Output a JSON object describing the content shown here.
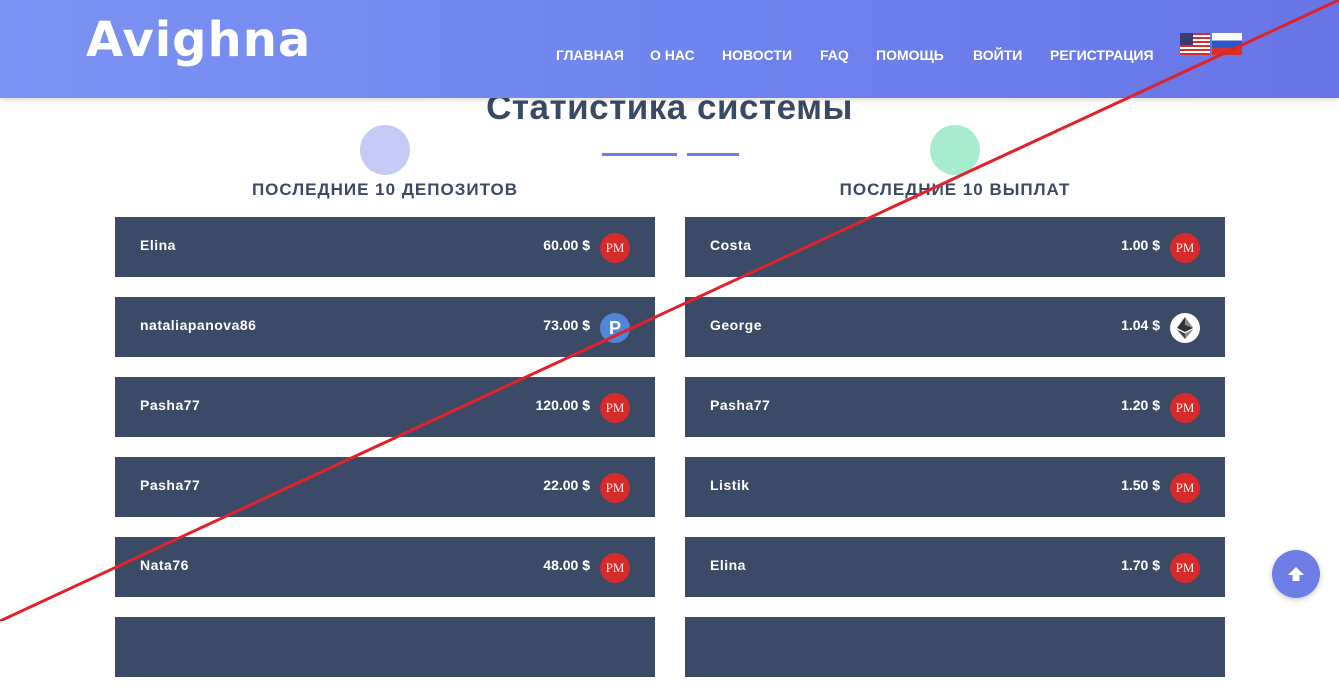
{
  "header": {
    "logo": "Avighna",
    "nav": [
      {
        "label": "ГЛАВНАЯ"
      },
      {
        "label": "О НАС"
      },
      {
        "label": "НОВОСТИ"
      },
      {
        "label": "FAQ"
      },
      {
        "label": "ПОМОЩЬ"
      },
      {
        "label": "ВОЙТИ"
      },
      {
        "label": "РЕГИСТРАЦИЯ"
      }
    ],
    "languages": [
      "us-flag-icon",
      "ru-flag-icon"
    ]
  },
  "stats": {
    "title": "Статистика системы",
    "deposits": {
      "heading": "ПОСЛЕДНИЕ 10 ДЕПОЗИТОВ",
      "rows": [
        {
          "name": "Elina",
          "amount": "60.00 $",
          "icon": "pm",
          "icon_text": "PM"
        },
        {
          "name": "nataliapanova86",
          "amount": "73.00 $",
          "icon": "payeer",
          "icon_text": "P"
        },
        {
          "name": "Pasha77",
          "amount": "120.00 $",
          "icon": "pm",
          "icon_text": "PM"
        },
        {
          "name": "Pasha77",
          "amount": "22.00 $",
          "icon": "pm",
          "icon_text": "PM"
        },
        {
          "name": "Nata76",
          "amount": "48.00 $",
          "icon": "pm",
          "icon_text": "PM"
        }
      ]
    },
    "payouts": {
      "heading": "ПОСЛЕДНИЕ 10 ВЫПЛАТ",
      "rows": [
        {
          "name": "Costa",
          "amount": "1.00 $",
          "icon": "pm",
          "icon_text": "PM"
        },
        {
          "name": "George",
          "amount": "1.04 $",
          "icon": "ethereum",
          "icon_text": ""
        },
        {
          "name": "Pasha77",
          "amount": "1.20 $",
          "icon": "pm",
          "icon_text": "PM"
        },
        {
          "name": "Listik",
          "amount": "1.50 $",
          "icon": "pm",
          "icon_text": "PM"
        },
        {
          "name": "Elina",
          "amount": "1.70 $",
          "icon": "pm",
          "icon_text": "PM"
        }
      ]
    }
  },
  "colors": {
    "header_start": "#7b93f3",
    "header_end": "#6875e6",
    "row_bg": "#3b4a66",
    "accent": "#6d7fe7",
    "pm_red": "#d52b2b",
    "strike_red": "#e0222b"
  },
  "scroll_top": {
    "icon": "arrow-up-icon"
  }
}
